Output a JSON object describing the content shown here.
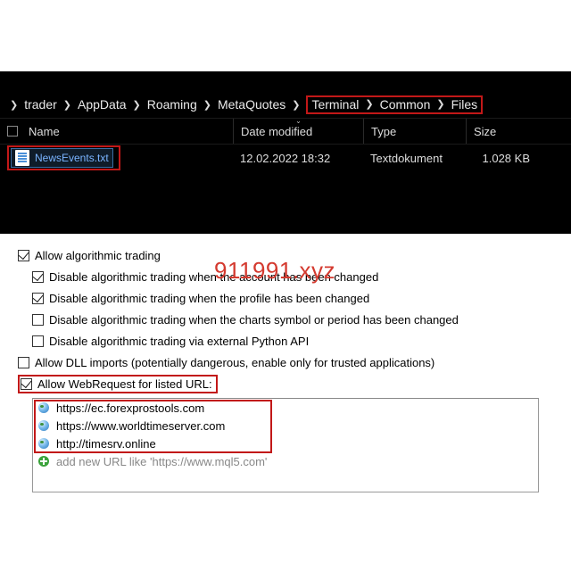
{
  "breadcrumb": {
    "items": [
      "trader",
      "AppData",
      "Roaming",
      "MetaQuotes"
    ],
    "highlighted": [
      "Terminal",
      "Common",
      "Files"
    ]
  },
  "columns": {
    "name": "Name",
    "date": "Date modified",
    "type": "Type",
    "size": "Size"
  },
  "file": {
    "name": "NewsEvents.txt",
    "date": "12.02.2022 18:32",
    "type": "Textdokument",
    "size": "1.028 KB"
  },
  "options": {
    "algo": "Allow algorithmic trading",
    "disable_account": "Disable algorithmic trading when the account has been changed",
    "disable_profile": "Disable algorithmic trading when the profile has been changed",
    "disable_symbol": "Disable algorithmic trading when the charts symbol or period has been changed",
    "disable_python": "Disable algorithmic trading via external Python API",
    "dll": "Allow DLL imports (potentially dangerous, enable only for trusted applications)",
    "webrequest": "Allow WebRequest for listed URL:"
  },
  "urls": {
    "list": [
      "https://ec.forexprostools.com",
      "https://www.worldtimeserver.com",
      "http://timesrv.online"
    ],
    "hint": "add new URL like 'https://www.mql5.com'"
  },
  "watermark": "911991.xyz"
}
